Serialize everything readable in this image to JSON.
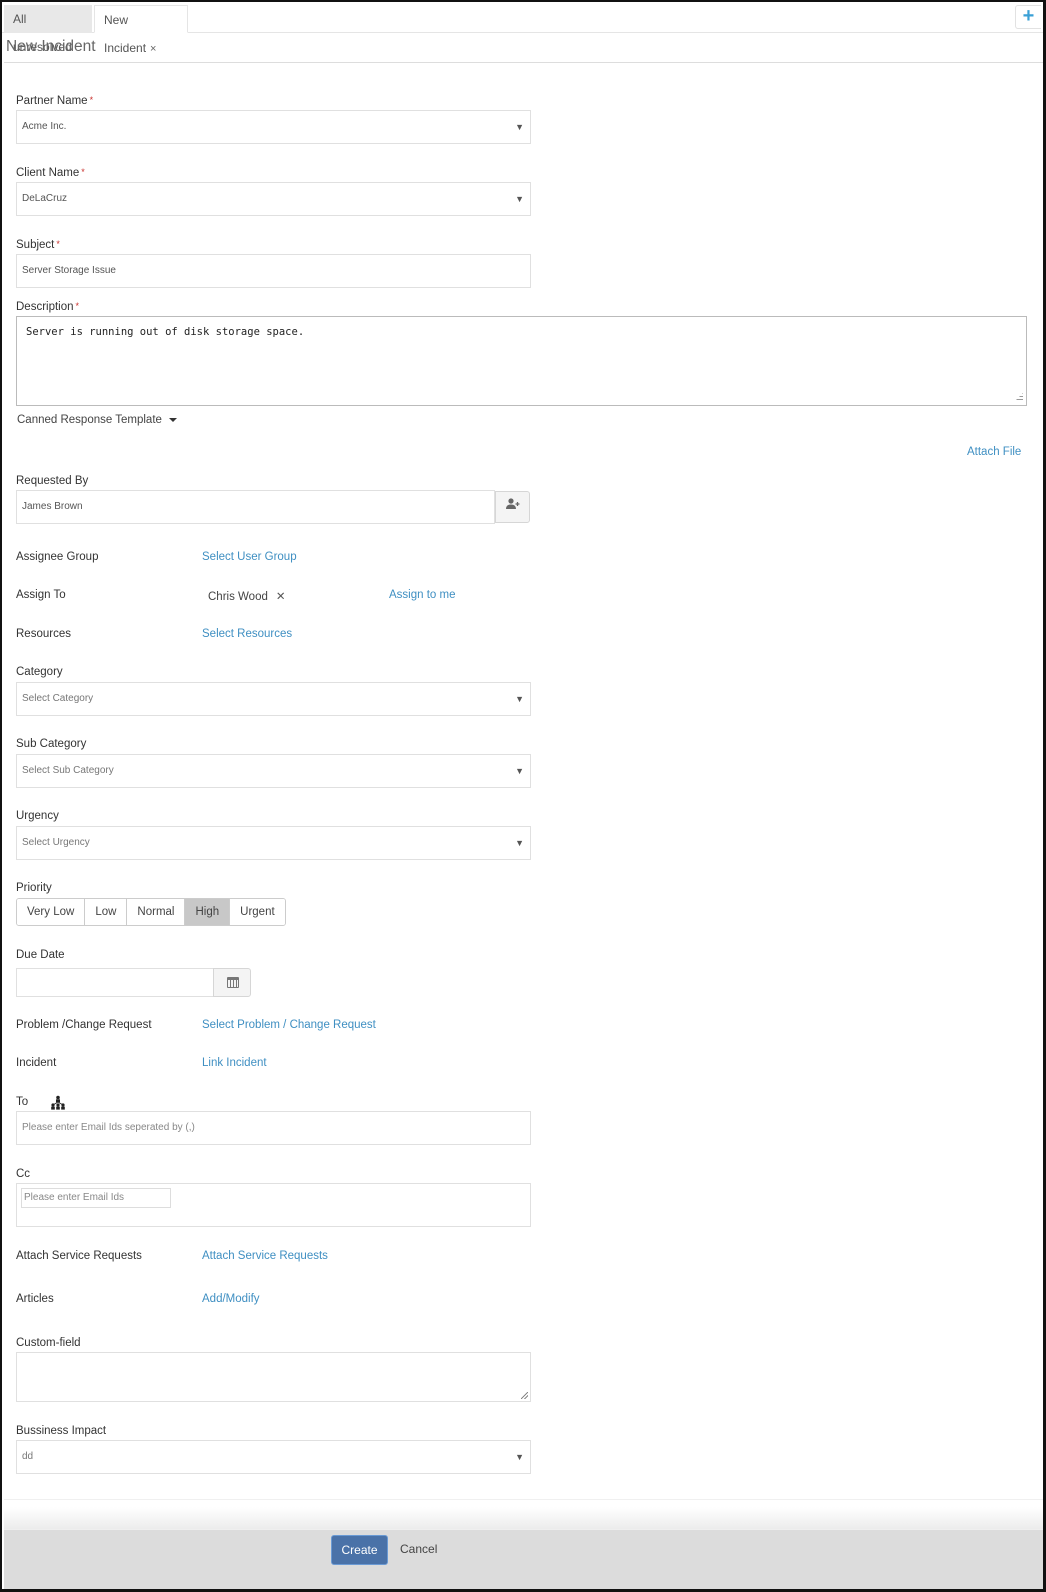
{
  "tabs": [
    {
      "label": "All unresolved",
      "active": false
    },
    {
      "label": "New Incident",
      "active": true,
      "close_icon": "×"
    }
  ],
  "add_tab_icon": "+",
  "page_title": "New Incident",
  "form": {
    "partner_name": {
      "label": "Partner Name",
      "required": "*",
      "value": "Acme Inc."
    },
    "client_name": {
      "label": "Client Name",
      "required": "*",
      "value": "DeLaCruz"
    },
    "subject": {
      "label": "Subject",
      "required": "*",
      "value": "Server Storage Issue"
    },
    "description": {
      "label": "Description",
      "required": "*",
      "value": "Server is running out of disk storage space."
    },
    "canned_response": {
      "label": "Canned Response Template"
    },
    "attach_file": {
      "label": "Attach File"
    },
    "requested_by": {
      "label": "Requested By",
      "value": "James Brown"
    },
    "assignee_group": {
      "label": "Assignee Group",
      "link": "Select User Group"
    },
    "assign_to": {
      "label": "Assign To",
      "value": "Chris Wood",
      "remove_icon": "✕",
      "link": "Assign to me"
    },
    "resources": {
      "label": "Resources",
      "link": "Select Resources"
    },
    "category": {
      "label": "Category",
      "placeholder": "Select Category"
    },
    "sub_category": {
      "label": "Sub Category",
      "placeholder": "Select Sub Category"
    },
    "urgency": {
      "label": "Urgency",
      "placeholder": "Select Urgency"
    },
    "priority": {
      "label": "Priority",
      "options": [
        "Very Low",
        "Low",
        "Normal",
        "High",
        "Urgent"
      ],
      "selected": "High"
    },
    "due_date": {
      "label": "Due Date",
      "value": ""
    },
    "problem_change": {
      "label": "Problem /Change Request",
      "link": "Select Problem / Change Request"
    },
    "incident": {
      "label": "Incident",
      "link": "Link Incident"
    },
    "to": {
      "label": "To",
      "placeholder": "Please enter Email Ids seperated by (,)"
    },
    "cc": {
      "label": "Cc",
      "placeholder": "Please enter Email Ids"
    },
    "attach_service_requests": {
      "label": "Attach Service Requests",
      "link": "Attach Service Requests"
    },
    "articles": {
      "label": "Articles",
      "link": "Add/Modify"
    },
    "custom_field": {
      "label": "Custom-field",
      "value": ""
    },
    "business_impact": {
      "label": "Bussiness Impact",
      "value": "dd"
    }
  },
  "footer": {
    "create_label": "Create",
    "cancel_label": "Cancel"
  },
  "colors": {
    "link": "#3f8fc2",
    "primary_button": "#4a72a8",
    "selected_priority": "#c8c8c8",
    "required": "#c9302c"
  }
}
